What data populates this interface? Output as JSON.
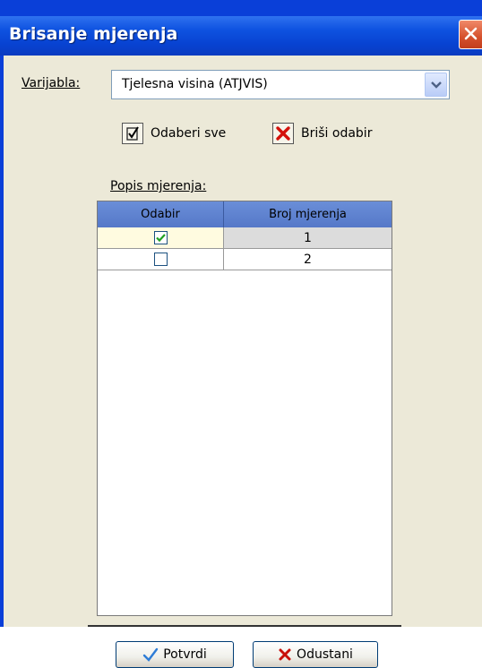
{
  "window": {
    "title": "Brisanje mjerenja"
  },
  "variable": {
    "label": "Varijabla:",
    "selected": "Tjelesna visina (ATJVIS)"
  },
  "toolbar": {
    "select_all": "Odaberi sve",
    "clear_selection": "Briši odabir"
  },
  "list": {
    "label": "Popis mjerenja:",
    "columns": [
      "Odabir",
      "Broj mjerenja"
    ],
    "rows": [
      {
        "checked": true,
        "number": "1"
      },
      {
        "checked": false,
        "number": "2"
      }
    ]
  },
  "buttons": {
    "confirm": "Potvrdi",
    "cancel": "Odustani"
  },
  "colors": {
    "titlebar": "#0843d2",
    "header": "#5f83d0",
    "selected_row": "#fffbe0",
    "close": "#d5502c"
  },
  "icons": {
    "close": "close-icon",
    "select_all": "checkbox-checked-icon",
    "clear": "red-x-icon",
    "confirm": "checkmark-icon",
    "cancel": "red-x-icon",
    "dropdown": "chevron-down-icon"
  }
}
